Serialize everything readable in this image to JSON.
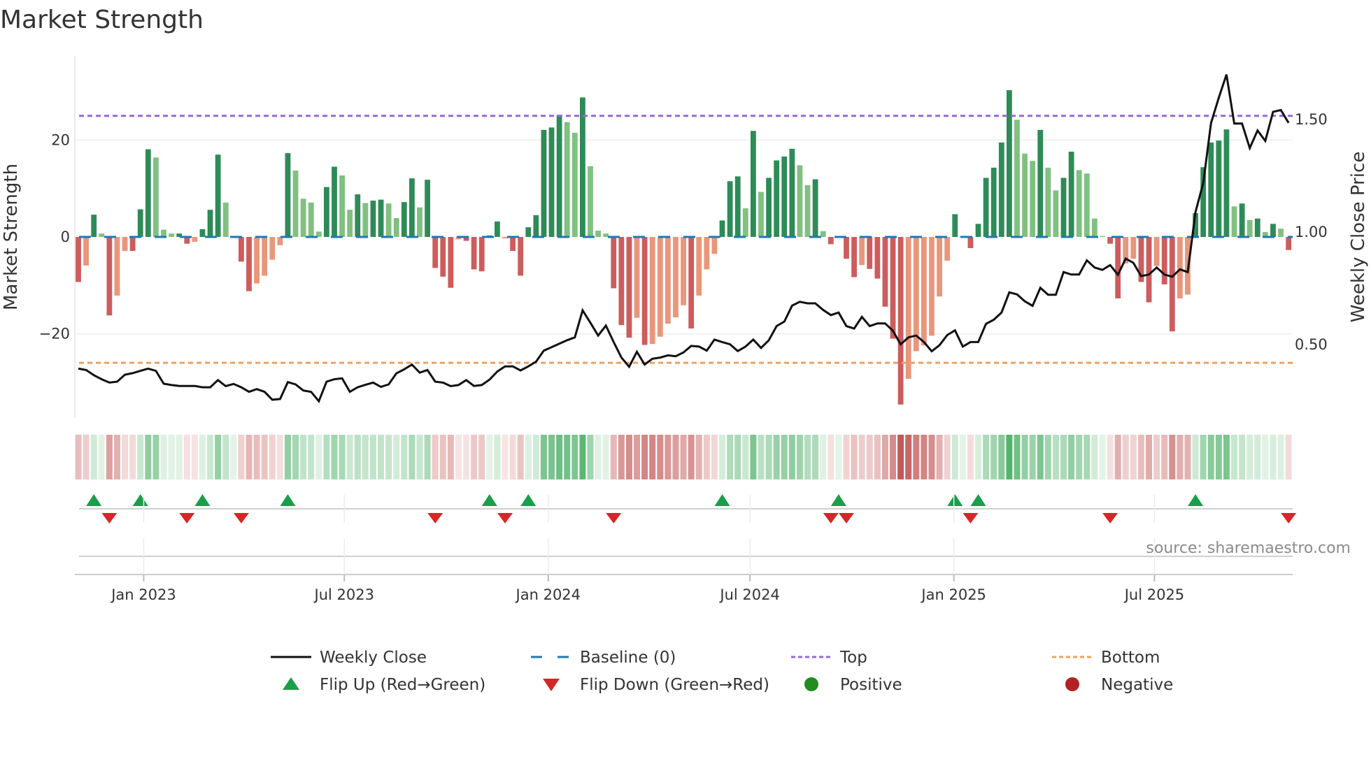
{
  "chart_data": {
    "type": "bar",
    "title": "Market Strength",
    "ylabel": "Market Strength",
    "y2label": "Weekly Close Price",
    "ylim": [
      -36,
      34
    ],
    "y2ticks": [
      "1.50",
      "1.00",
      "0.50"
    ],
    "y2tick_values": [
      1.5,
      1.0,
      0.5
    ],
    "yticks": [
      "20",
      "0",
      "−20"
    ],
    "ytick_values": [
      20,
      0,
      -20
    ],
    "top_level": 25,
    "bottom_level": -26,
    "baseline": 0,
    "start_week": "2022-11-03",
    "interval_days": 7,
    "x_ticks": [
      {
        "label": "Jan 2023",
        "date": "2023-01-01"
      },
      {
        "label": "Jul 2023",
        "date": "2023-07-01"
      },
      {
        "label": "Jan 2024",
        "date": "2024-01-01"
      },
      {
        "label": "Jul 2024",
        "date": "2024-07-01"
      },
      {
        "label": "Jan 2025",
        "date": "2025-01-01"
      },
      {
        "label": "Jul 2025",
        "date": "2025-07-01"
      }
    ],
    "strength": [
      -9.3,
      -5.9,
      4.6,
      0.7,
      -16.2,
      -12.1,
      -2.9,
      -2.9,
      5.7,
      18.1,
      16.4,
      1.5,
      0.7,
      0.7,
      -1.4,
      -1.0,
      1.6,
      5.6,
      17.0,
      7.1,
      0.2,
      -5.1,
      -11.2,
      -9.6,
      -8.0,
      -4.7,
      -1.7,
      17.3,
      13.7,
      7.9,
      7.1,
      1.1,
      10.3,
      14.5,
      12.7,
      5.6,
      8.8,
      7.0,
      7.5,
      7.7,
      6.9,
      3.9,
      7.2,
      12.1,
      6.1,
      11.8,
      -6.4,
      -8.2,
      -10.5,
      -0.5,
      -0.8,
      -6.7,
      -7.1,
      0.3,
      3.2,
      -0.3,
      -2.9,
      -8.0,
      2.0,
      4.5,
      22.1,
      22.6,
      25.2,
      23.7,
      21.5,
      28.8,
      14.6,
      1.3,
      0.7,
      -10.6,
      -18.2,
      -20.8,
      -16.7,
      -22.3,
      -22.1,
      -20.6,
      -17.9,
      -16.6,
      -14.1,
      -18.9,
      -12.1,
      -6.7,
      -3.5,
      3.4,
      11.5,
      12.5,
      5.9,
      21.9,
      9.3,
      12.2,
      15.8,
      16.6,
      18.2,
      14.8,
      10.7,
      11.9,
      1.2,
      -1.5,
      0.2,
      -4.5,
      -8.3,
      -5.8,
      -6.6,
      -8.6,
      -14.4,
      -21.0,
      -34.6,
      -29.3,
      -23.6,
      -22.4,
      -20.4,
      -12.3,
      -4.9,
      4.7,
      0.2,
      -2.3,
      2.7,
      12.2,
      14.3,
      19.5,
      30.3,
      24.2,
      17.2,
      15.7,
      22.1,
      14.3,
      9.6,
      12.2,
      17.6,
      13.8,
      13.1,
      3.8,
      0.2,
      -1.4,
      -12.7,
      -5.5,
      -4.5,
      -9.3,
      -13.5,
      -6.0,
      -9.8,
      -19.5,
      -12.7,
      -11.9,
      4.9,
      14.4,
      19.5,
      19.9,
      22.2,
      6.3,
      6.9,
      3.5,
      3.8,
      1.0,
      2.7,
      1.7,
      -2.7
    ],
    "shade": [
      "d",
      "l",
      "d",
      "l",
      "d",
      "l",
      "l",
      "d",
      "d",
      "d",
      "l",
      "l",
      "l",
      "d",
      "d",
      "l",
      "d",
      "d",
      "d",
      "l",
      "l",
      "d",
      "d",
      "l",
      "l",
      "l",
      "l",
      "d",
      "l",
      "l",
      "l",
      "l",
      "d",
      "d",
      "l",
      "l",
      "d",
      "l",
      "d",
      "d",
      "l",
      "l",
      "d",
      "d",
      "l",
      "d",
      "d",
      "d",
      "d",
      "l",
      "d",
      "d",
      "d",
      "d",
      "d",
      "l",
      "d",
      "d",
      "d",
      "d",
      "d",
      "d",
      "d",
      "l",
      "l",
      "d",
      "l",
      "l",
      "l",
      "d",
      "d",
      "d",
      "l",
      "d",
      "l",
      "l",
      "l",
      "l",
      "l",
      "d",
      "l",
      "l",
      "l",
      "d",
      "d",
      "d",
      "l",
      "d",
      "l",
      "d",
      "d",
      "d",
      "d",
      "l",
      "l",
      "d",
      "l",
      "d",
      "l",
      "d",
      "d",
      "l",
      "d",
      "d",
      "d",
      "d",
      "d",
      "l",
      "l",
      "l",
      "l",
      "l",
      "l",
      "d",
      "l",
      "d",
      "d",
      "d",
      "d",
      "d",
      "d",
      "l",
      "l",
      "l",
      "d",
      "l",
      "l",
      "d",
      "d",
      "l",
      "l",
      "l",
      "l",
      "d",
      "d",
      "l",
      "l",
      "d",
      "d",
      "l",
      "d",
      "d",
      "l",
      "l",
      "d",
      "d",
      "d",
      "d",
      "d",
      "l",
      "d",
      "l",
      "d",
      "l",
      "d",
      "l",
      "d"
    ],
    "weekly_close": [
      0.39,
      0.384,
      0.361,
      0.343,
      0.328,
      0.332,
      0.363,
      0.37,
      0.38,
      0.39,
      0.38,
      0.323,
      0.317,
      0.313,
      0.313,
      0.313,
      0.307,
      0.307,
      0.339,
      0.312,
      0.322,
      0.307,
      0.287,
      0.299,
      0.287,
      0.252,
      0.255,
      0.33,
      0.32,
      0.293,
      0.287,
      0.245,
      0.332,
      0.343,
      0.347,
      0.287,
      0.307,
      0.318,
      0.328,
      0.309,
      0.32,
      0.369,
      0.387,
      0.408,
      0.372,
      0.384,
      0.332,
      0.328,
      0.312,
      0.317,
      0.339,
      0.313,
      0.317,
      0.341,
      0.377,
      0.4,
      0.4,
      0.382,
      0.4,
      0.421,
      0.47,
      0.485,
      0.501,
      0.516,
      0.529,
      0.649,
      0.594,
      0.537,
      0.581,
      0.508,
      0.439,
      0.398,
      0.465,
      0.408,
      0.434,
      0.439,
      0.449,
      0.445,
      0.462,
      0.491,
      0.488,
      0.47,
      0.519,
      0.508,
      0.498,
      0.468,
      0.488,
      0.519,
      0.482,
      0.516,
      0.579,
      0.599,
      0.67,
      0.687,
      0.68,
      0.68,
      0.651,
      0.628,
      0.639,
      0.579,
      0.568,
      0.62,
      0.579,
      0.591,
      0.591,
      0.558,
      0.498,
      0.529,
      0.537,
      0.508,
      0.467,
      0.494,
      0.539,
      0.56,
      0.488,
      0.508,
      0.508,
      0.589,
      0.607,
      0.639,
      0.729,
      0.72,
      0.689,
      0.669,
      0.749,
      0.718,
      0.718,
      0.819,
      0.808,
      0.808,
      0.871,
      0.839,
      0.829,
      0.85,
      0.807,
      0.879,
      0.86,
      0.801,
      0.808,
      0.839,
      0.808,
      0.798,
      0.831,
      0.819,
      1.086,
      1.215,
      1.481,
      1.593,
      1.697,
      1.479,
      1.479,
      1.37,
      1.448,
      1.402,
      1.531,
      1.539,
      1.482
    ],
    "legend": {
      "placement": "bottom",
      "items": [
        {
          "label": "Weekly Close",
          "kind": "line"
        },
        {
          "label": "Baseline (0)",
          "kind": "dash"
        },
        {
          "label": "Top",
          "kind": "dot-top"
        },
        {
          "label": "Bottom",
          "kind": "dot-bottom"
        },
        {
          "label": "Flip Up (Red→Green)",
          "kind": "tri-up"
        },
        {
          "label": "Flip Down (Green→Red)",
          "kind": "tri-down"
        },
        {
          "label": "Positive",
          "kind": "circle-pos"
        },
        {
          "label": "Negative",
          "kind": "circle-neg"
        }
      ]
    },
    "source": "source: sharemaestro.com",
    "colors": {
      "pos_strong": "#2e8b57",
      "pos_weak": "#80c080",
      "neg_strong": "#cd5c5c",
      "neg_weak": "#e9967a",
      "baseline": "#1f77b4",
      "top": "#9966dd",
      "bottom": "#f0a060",
      "price": "#111111",
      "flip_up": "#1a9e4a",
      "flip_down": "#d62728",
      "positive": "#228b22",
      "negative": "#b22222",
      "heat_pos": "#41ab5d",
      "heat_neg": "#c0504d"
    }
  }
}
